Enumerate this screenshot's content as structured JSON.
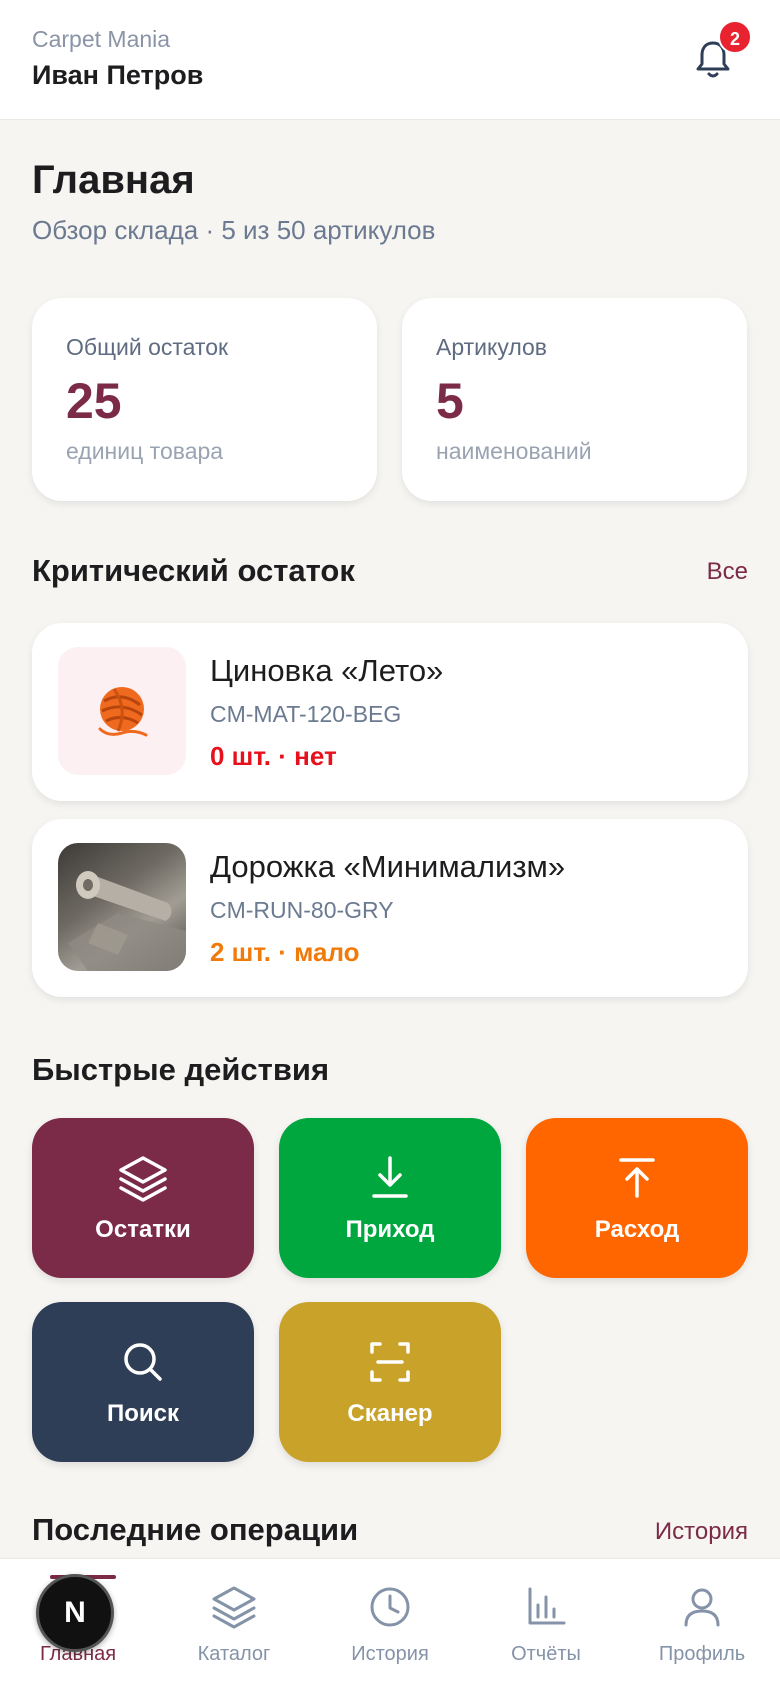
{
  "header": {
    "brand": "Carpet Mania",
    "user_name": "Иван Петров",
    "notifications_count": "2",
    "bell_icon": "bell-icon"
  },
  "page": {
    "title": "Главная",
    "subtitle": "Обзор склада · 5 из 50 артикулов"
  },
  "stats": [
    {
      "label": "Общий остаток",
      "value": "25",
      "note": "единиц товара"
    },
    {
      "label": "Артикулов",
      "value": "5",
      "note": "наименований"
    }
  ],
  "critical": {
    "title": "Критический остаток",
    "link": "Все",
    "items": [
      {
        "name": "Циновка «Лето»",
        "sku": "CM-MAT-120-BEG",
        "stock": "0 шт. · нет",
        "status_color": "#e8101c",
        "thumb": "yarn-ball-icon"
      },
      {
        "name": "Дорожка «Минимализм»",
        "sku": "CM-RUN-80-GRY",
        "stock": "2 шт. · мало",
        "status_color": "#f07a0a",
        "thumb": "rug-photo"
      }
    ]
  },
  "quick_actions": {
    "title": "Быстрые действия",
    "items": [
      {
        "label": "Остатки",
        "color": "#7b2a47",
        "icon": "layers-icon"
      },
      {
        "label": "Приход",
        "color": "#00a63e",
        "icon": "download-icon"
      },
      {
        "label": "Расход",
        "color": "#ff6600",
        "icon": "upload-icon"
      },
      {
        "label": "Поиск",
        "color": "#2f3e57",
        "icon": "search-icon"
      },
      {
        "label": "Сканер",
        "color": "#c9a22a",
        "icon": "scan-icon"
      }
    ]
  },
  "recent": {
    "title": "Последние операции",
    "link": "История"
  },
  "bottom_nav": {
    "items": [
      {
        "label": "Главная",
        "icon": "home-icon",
        "active": true
      },
      {
        "label": "Каталог",
        "icon": "layers-icon",
        "active": false
      },
      {
        "label": "История",
        "icon": "clock-icon",
        "active": false
      },
      {
        "label": "Отчёты",
        "icon": "bar-chart-icon",
        "active": false
      },
      {
        "label": "Профиль",
        "icon": "user-icon",
        "active": false
      }
    ]
  },
  "overlay_button": {
    "label": "N"
  },
  "colors": {
    "accent": "#7b2a47",
    "background": "#f6f5f2",
    "badge": "#e8222e"
  }
}
